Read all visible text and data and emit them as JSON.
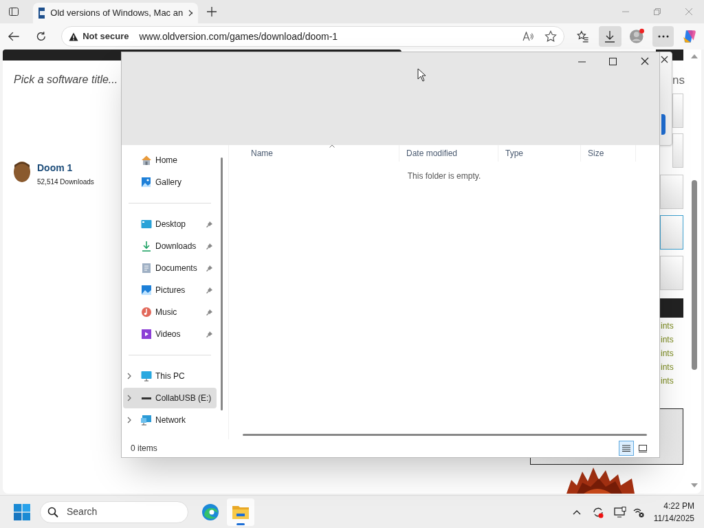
{
  "browser": {
    "tabs": [
      {
        "title": "Old versions of Windows, Mac an",
        "selected": true
      }
    ],
    "address": {
      "security": "Not secure",
      "url": "www.oldversion.com/games/download/doom-1"
    }
  },
  "web_page": {
    "search_placeholder": "Pick a software title...",
    "result": {
      "title": "Doom 1",
      "downloads": "52,514 Downloads"
    },
    "side_heading": "ns",
    "side_links": [
      "ints",
      "ints",
      "ints",
      "ints",
      "ints"
    ]
  },
  "explorer": {
    "nav_groups": [
      [
        {
          "label": "Home",
          "pinned": false,
          "expandable": false,
          "selected": false
        },
        {
          "label": "Gallery",
          "pinned": false,
          "expandable": false,
          "selected": false
        }
      ],
      [
        {
          "label": "Desktop",
          "pinned": true,
          "expandable": false,
          "selected": false
        },
        {
          "label": "Downloads",
          "pinned": true,
          "expandable": false,
          "selected": false
        },
        {
          "label": "Documents",
          "pinned": true,
          "expandable": false,
          "selected": false
        },
        {
          "label": "Pictures",
          "pinned": true,
          "expandable": false,
          "selected": false
        },
        {
          "label": "Music",
          "pinned": true,
          "expandable": false,
          "selected": false
        },
        {
          "label": "Videos",
          "pinned": true,
          "expandable": false,
          "selected": false
        }
      ],
      [
        {
          "label": "This PC",
          "pinned": false,
          "expandable": true,
          "selected": false
        },
        {
          "label": "CollabUSB (E:)",
          "pinned": false,
          "expandable": true,
          "selected": true
        },
        {
          "label": "Network",
          "pinned": false,
          "expandable": true,
          "selected": false
        }
      ]
    ],
    "columns": [
      {
        "label": "Name",
        "sorted": true
      },
      {
        "label": "Date modified",
        "sorted": false
      },
      {
        "label": "Type",
        "sorted": false
      },
      {
        "label": "Size",
        "sorted": false
      }
    ],
    "empty_message": "This folder is empty.",
    "status": "0 items",
    "views": [
      {
        "kind": "details",
        "selected": true
      },
      {
        "kind": "tiles",
        "selected": false
      }
    ]
  },
  "taskbar": {
    "search_placeholder": "Search",
    "apps": [
      {
        "kind": "edge",
        "selected": false
      },
      {
        "kind": "explorer",
        "selected": true
      }
    ],
    "time": "4:22 PM",
    "date": "11/14/2025"
  }
}
